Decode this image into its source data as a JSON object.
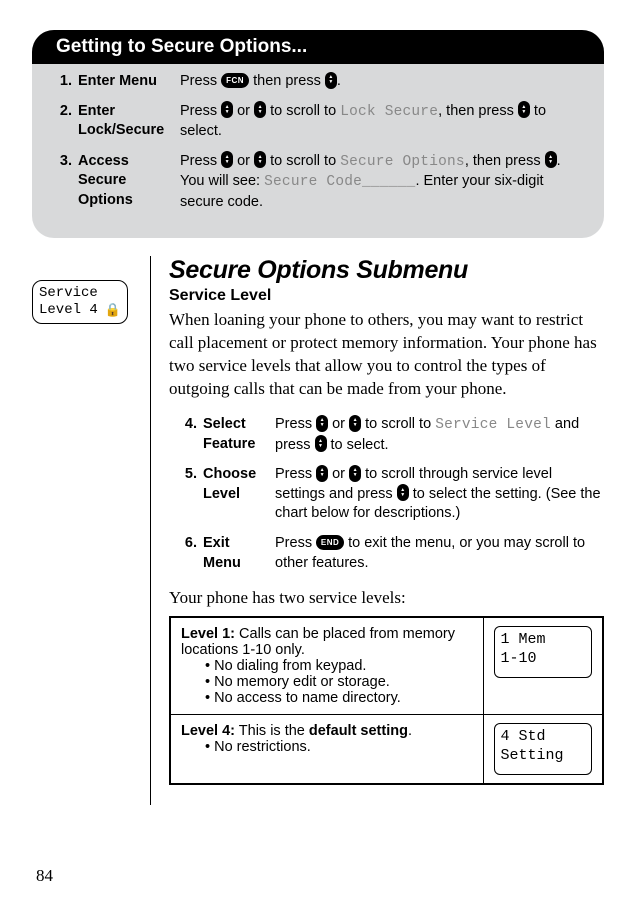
{
  "panel": {
    "header": "Getting to Secure Options...",
    "steps": [
      {
        "num": "1.",
        "label": "Enter Menu",
        "parts": [
          "Press ",
          {
            "icon": "FCN",
            "shape": "oval"
          },
          " then press ",
          {
            "icon": "updown",
            "shape": "tall"
          },
          "."
        ]
      },
      {
        "num": "2.",
        "label": "Enter Lock/Secure",
        "parts": [
          "Press ",
          {
            "icon": "up",
            "shape": "tall"
          },
          " or ",
          {
            "icon": "down",
            "shape": "tall"
          },
          " to scroll to ",
          {
            "lcd": "Lock Secure"
          },
          ", then press ",
          {
            "icon": "updown",
            "shape": "tall"
          },
          " to select."
        ]
      },
      {
        "num": "3.",
        "label": "Access Secure Options",
        "parts": [
          "Press ",
          {
            "icon": "up",
            "shape": "tall"
          },
          " or ",
          {
            "icon": "down",
            "shape": "tall"
          },
          " to scroll to ",
          {
            "lcd": "Secure Options"
          },
          ", then press ",
          {
            "icon": "updown",
            "shape": "tall"
          },
          ". You will see: ",
          {
            "lcd": "Secure Code______"
          },
          ". Enter your six-digit secure code."
        ]
      }
    ]
  },
  "side_box": {
    "line1": "Service",
    "line2": "Level 4",
    "lock": "🔒"
  },
  "submenu": {
    "title": "Secure Options Submenu",
    "section": "Service Level",
    "intro": "When loaning your phone to others, you may want to restrict call placement or protect memory information. Your phone has two service levels that allow you to control the types of outgoing calls that can be made from your phone.",
    "steps": [
      {
        "num": "4.",
        "label": "Select Feature",
        "parts": [
          "Press ",
          {
            "icon": "up",
            "shape": "tall"
          },
          " or ",
          {
            "icon": "down",
            "shape": "tall"
          },
          " to scroll to ",
          {
            "lcd": "Service Level"
          },
          " and press ",
          {
            "icon": "updown",
            "shape": "tall"
          },
          " to select."
        ]
      },
      {
        "num": "5.",
        "label": "Choose Level",
        "parts": [
          "Press ",
          {
            "icon": "up",
            "shape": "tall"
          },
          " or ",
          {
            "icon": "down",
            "shape": "tall"
          },
          " to scroll through service level settings and press ",
          {
            "icon": "updown",
            "shape": "tall"
          },
          " to select the setting. (See the chart below for descriptions.)"
        ]
      },
      {
        "num": "6.",
        "label": "Exit Menu",
        "parts": [
          "Press ",
          {
            "icon": "END",
            "shape": "oval"
          },
          " to exit the menu, or you may scroll to other features."
        ]
      }
    ],
    "levels_intro": "Your phone has two service levels:",
    "levels": [
      {
        "title": "Level 1:",
        "desc": " Calls can be placed from memory locations 1-10 only.",
        "bullets": [
          "No dialing from keypad.",
          "No memory edit or storage.",
          "No access to name directory."
        ],
        "screen": [
          "1 Mem",
          "1-10"
        ]
      },
      {
        "title": "Level 4:",
        "desc_pre": " This is the ",
        "desc_bold": "default setting",
        "desc_post": ".",
        "bullets": [
          "No restrictions."
        ],
        "screen": [
          "4 Std",
          "Setting"
        ]
      }
    ]
  },
  "page_number": "84"
}
